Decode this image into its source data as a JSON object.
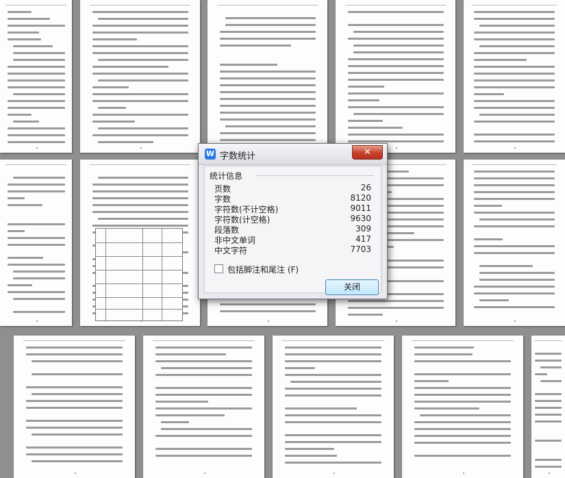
{
  "dialog": {
    "title": "字数统计",
    "close_glyph": "✕",
    "app_icon_letter": "W",
    "group_label": "统计信息",
    "stats": [
      {
        "label": "页数",
        "value": "26"
      },
      {
        "label": "字数",
        "value": "8120"
      },
      {
        "label": "字符数(不计空格)",
        "value": "9011"
      },
      {
        "label": "字符数(计空格)",
        "value": "9630"
      },
      {
        "label": "段落数",
        "value": "309"
      },
      {
        "label": "非中文单词",
        "value": "417"
      },
      {
        "label": "中文字符",
        "value": "7703"
      }
    ],
    "include_footnotes_label": "包括脚注和尾注 (F)",
    "include_footnotes_checked": false,
    "close_button_label": "关闭"
  },
  "colors": {
    "workspace_bg": "#8f8f8f",
    "page_bg": "#fdfdfd",
    "title_close_red": "#c5412b",
    "button_border": "#3c7fb1",
    "app_icon_blue": "#2a7ae2"
  }
}
